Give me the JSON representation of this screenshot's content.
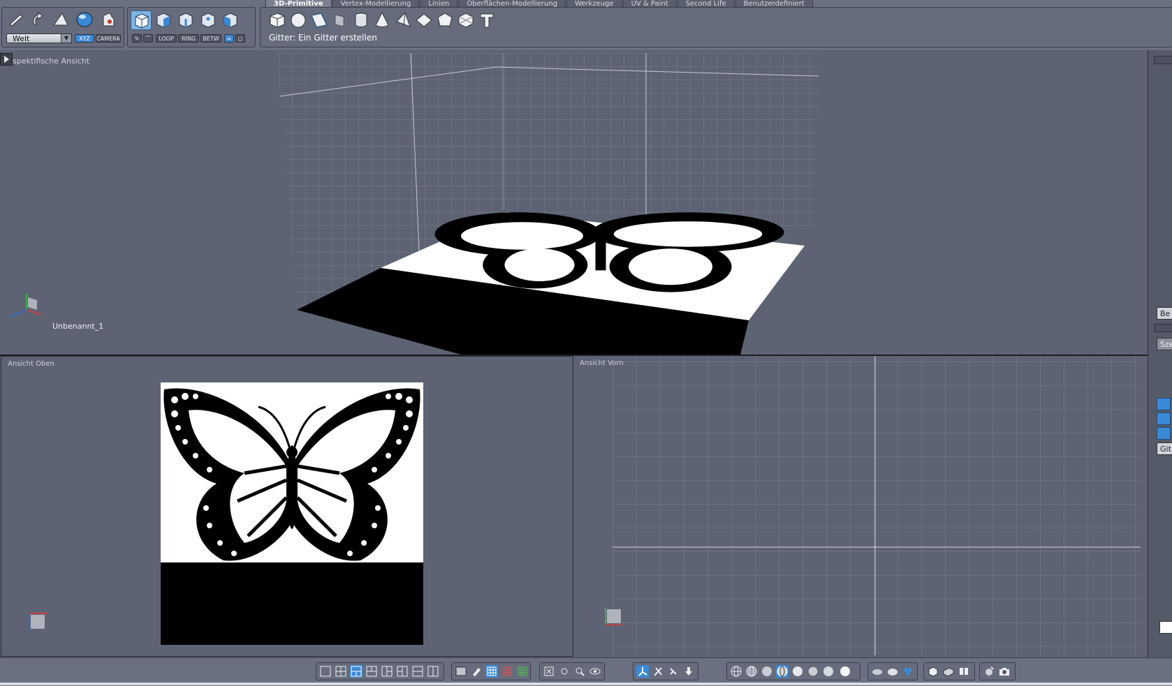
{
  "toolbar": {
    "coordinate_dropdown": "Welt",
    "xyz_button": "XYZ",
    "camera_button": "CAMERA",
    "loop_button": "LOOP",
    "ring_button": "RING",
    "betw_button": "BETW",
    "tabs": [
      {
        "label": "3D-Primitive",
        "active": true
      },
      {
        "label": "Vertex-Modellierung",
        "active": false
      },
      {
        "label": "Linien",
        "active": false
      },
      {
        "label": "Oberflächen-Modellierung",
        "active": false
      },
      {
        "label": "Werkzeuge",
        "active": false
      },
      {
        "label": "UV & Paint",
        "active": false
      },
      {
        "label": "Second Life",
        "active": false
      },
      {
        "label": "Benutzerdefiniert",
        "active": false
      }
    ],
    "status": "Gitter: Ein Gitter erstellen",
    "primitive_icons": [
      "cube-icon",
      "sphere-icon",
      "plane-icon",
      "grid-icon",
      "cylinder-icon",
      "cone-icon",
      "pyramid-icon",
      "disc-icon",
      "dodecahedron-icon",
      "icosahedron-icon",
      "text-icon"
    ]
  },
  "viewports": {
    "perspective": {
      "label": "erspektifische Ansicht",
      "object_name": "Unbenannt_1"
    },
    "top": {
      "label": "Ansicht Oben"
    },
    "front": {
      "label": "Ansicht Vorn"
    }
  },
  "right_panel": {
    "btn1": "Be",
    "btn2": "Sze",
    "btn3": "Git"
  },
  "colors": {
    "accent": "#3a89d6",
    "background": "#5d6373",
    "toolbar": "#6a7080"
  }
}
